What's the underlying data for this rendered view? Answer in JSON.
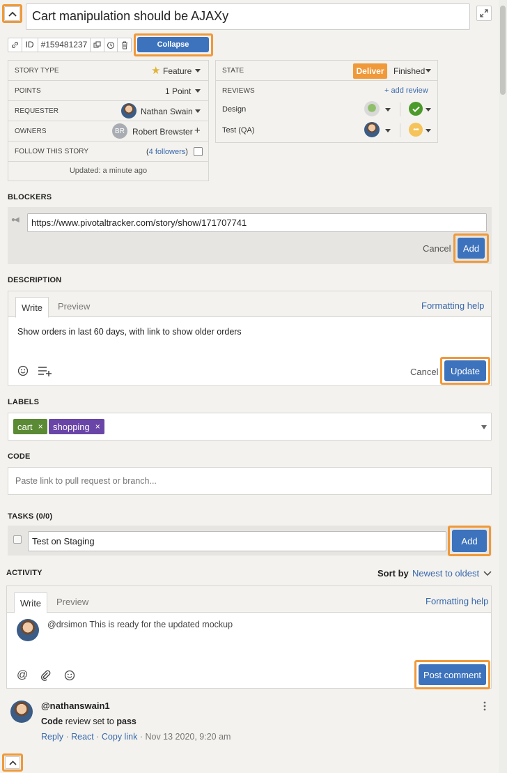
{
  "story": {
    "title": "Cart manipulation should be AJAXy",
    "id_label": "ID",
    "id_value": "#159481237",
    "collapse_label": "Collapse",
    "updated": "Updated: a minute ago"
  },
  "details": {
    "story_type_label": "STORY TYPE",
    "story_type_value": "Feature",
    "points_label": "POINTS",
    "points_value": "1 Point",
    "requester_label": "REQUESTER",
    "requester_value": "Nathan Swain",
    "owners_label": "OWNERS",
    "owners_initials": "BR",
    "owners_value": "Robert Brewster",
    "follow_label": "FOLLOW THIS STORY",
    "followers_link": "4 followers",
    "followers_open": "(",
    "followers_close": ")"
  },
  "state": {
    "label": "STATE",
    "deliver_label": "Deliver",
    "status_value": "Finished",
    "reviews_label": "REVIEWS",
    "add_review": "+ add review",
    "reviews": [
      {
        "name": "Design"
      },
      {
        "name": "Test (QA)"
      }
    ]
  },
  "blockers": {
    "title": "BLOCKERS",
    "input_value": "https://www.pivotaltracker.com/story/show/171707741",
    "cancel_label": "Cancel",
    "add_label": "Add"
  },
  "description": {
    "title": "DESCRIPTION",
    "tab_write": "Write",
    "tab_preview": "Preview",
    "formatting_help": "Formatting help",
    "text": "Show orders in last 60 days, with link to show older orders",
    "cancel_label": "Cancel",
    "update_label": "Update"
  },
  "labels": {
    "title": "LABELS",
    "items": [
      {
        "name": "cart",
        "color": "#5a8a33"
      },
      {
        "name": "shopping",
        "color": "#6a45a8"
      }
    ],
    "remove_glyph": "×"
  },
  "code": {
    "title": "CODE",
    "placeholder": "Paste link to pull request or branch..."
  },
  "tasks": {
    "title": "TASKS (0/0)",
    "input_value": "Test on Staging",
    "add_label": "Add"
  },
  "activity": {
    "title": "ACTIVITY",
    "sort_label": "Sort by",
    "sort_value": "Newest to oldest",
    "tab_write": "Write",
    "tab_preview": "Preview",
    "formatting_help": "Formatting help",
    "comment_text": "@drsimon This is ready for the updated mockup",
    "post_label": "Post comment",
    "entry": {
      "user": "@nathanswain1",
      "text_bold_1": "Code",
      "text_middle": " review set to ",
      "text_bold_2": "pass",
      "reply": "Reply",
      "react": "React",
      "copy_link": "Copy link",
      "separator": "·",
      "timestamp": "Nov 13 2020, 9:20 am"
    }
  },
  "colors": {
    "accent_blue": "#3d73bd",
    "highlight_orange": "#f0993a",
    "deliver_orange": "#f0993a",
    "label_green": "#5a8a33",
    "label_purple": "#6a45a8"
  }
}
